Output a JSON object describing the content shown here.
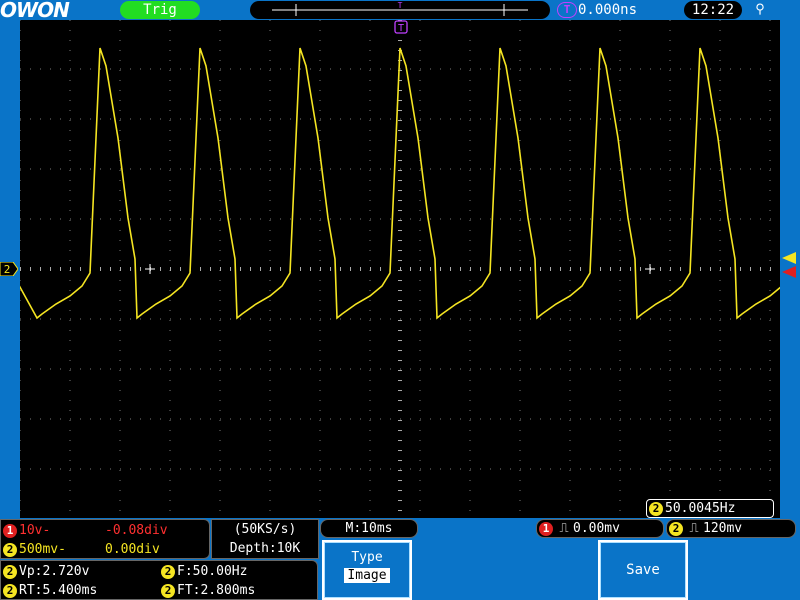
{
  "brand": "OWON",
  "header": {
    "trigger_status": "Trig",
    "trigger_position_label": "T",
    "trigger_position": "0.000ns",
    "clock": "12:22",
    "usb_icon": "usb-icon"
  },
  "screen": {
    "channel2_marker": "2",
    "frequency_badge": "2",
    "frequency": "50.0045Hz",
    "colors": {
      "ch2_trace": "#f5e522",
      "trigger_level_marker": "#e02020",
      "grid": "#7a7a7a"
    }
  },
  "channels": [
    {
      "badge": "1",
      "scale": "10v-",
      "offset": "-0.08div"
    },
    {
      "badge": "2",
      "scale": "500mv-",
      "offset": "0.00div"
    }
  ],
  "acquisition": {
    "rate": "(50KS/s)",
    "depth": "Depth:10K"
  },
  "timebase": "M:10ms",
  "triggers": [
    {
      "badge": "1",
      "value": "0.00mv"
    },
    {
      "badge": "2",
      "value": "120mv"
    }
  ],
  "measurements": [
    {
      "badge": "2",
      "text": "Vp:2.720v"
    },
    {
      "badge": "2",
      "text": "F:50.00Hz"
    },
    {
      "badge": "2",
      "text": "RT:5.400ms"
    },
    {
      "badge": "2",
      "text": "FT:2.800ms"
    }
  ],
  "softkeys": {
    "type_label": "Type",
    "type_value": "Image",
    "save_label": "Save"
  }
}
